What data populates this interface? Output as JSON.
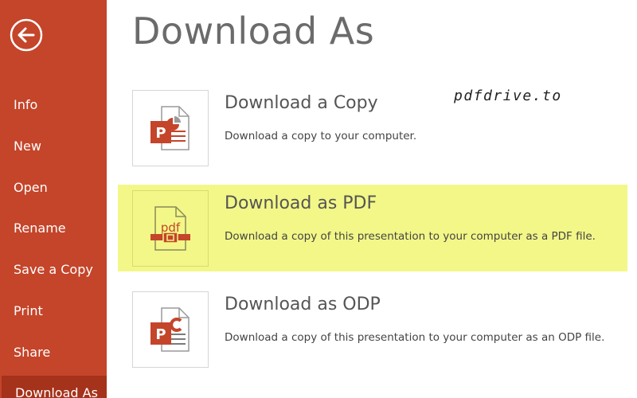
{
  "sidebar": {
    "back_icon": "back-arrow-icon",
    "items": [
      {
        "label": "Info"
      },
      {
        "label": "New"
      },
      {
        "label": "Open"
      },
      {
        "label": "Rename"
      },
      {
        "label": "Save a Copy"
      },
      {
        "label": "Print"
      },
      {
        "label": "Share"
      },
      {
        "label": "Download As",
        "active": true
      }
    ],
    "color": "#c4452a",
    "active_color": "#a5321b"
  },
  "main": {
    "title": "Download As",
    "watermark": "pdfdrive.to",
    "options": [
      {
        "title": "Download a Copy",
        "description": "Download a copy to your computer.",
        "icon": "powerpoint-file-icon"
      },
      {
        "title": "Download as PDF",
        "description": "Download a copy of this presentation to your computer as a PDF file.",
        "icon": "pdf-file-icon",
        "icon_label": "pdf",
        "highlighted": true,
        "highlight_color": "#f3f787"
      },
      {
        "title": "Download as ODP",
        "description": "Download a copy of this presentation to your computer as an ODP file.",
        "icon": "odp-file-icon"
      }
    ]
  }
}
